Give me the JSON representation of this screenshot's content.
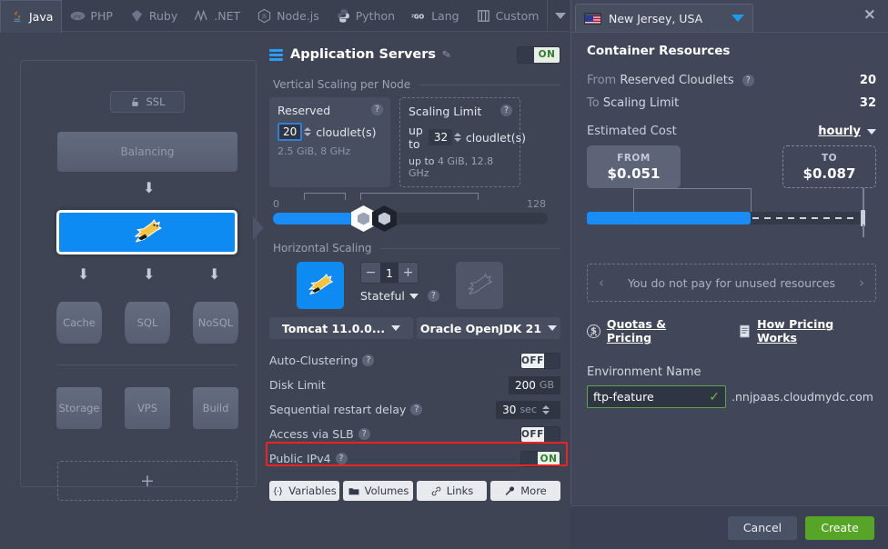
{
  "tabs": [
    {
      "label": "Java",
      "icon": "java-icon",
      "active": true
    },
    {
      "label": "PHP",
      "icon": "php-icon",
      "active": false
    },
    {
      "label": "Ruby",
      "icon": "ruby-icon",
      "active": false
    },
    {
      "label": ".NET",
      "icon": "dotnet-icon",
      "active": false
    },
    {
      "label": "Node.js",
      "icon": "nodejs-icon",
      "active": false
    },
    {
      "label": "Python",
      "icon": "python-icon",
      "active": false
    },
    {
      "label": "Lang",
      "icon": "go-icon",
      "active": false
    },
    {
      "label": "Custom",
      "icon": "custom-icon",
      "active": false
    }
  ],
  "topology": {
    "ssl_label": "SSL",
    "balancing_label": "Balancing",
    "selected_node": "tomcat-node",
    "databases": [
      "Cache",
      "SQL",
      "NoSQL"
    ],
    "services": [
      "Storage",
      "VPS",
      "Build"
    ],
    "add_label": "+"
  },
  "middle": {
    "title": "Application Servers",
    "enabled_label": "ON",
    "vertical_section": "Vertical Scaling per Node",
    "reserved": {
      "title": "Reserved",
      "value": "20",
      "unit": "cloudlet(s)",
      "detail": "2.5 GiB, 8 GHz"
    },
    "scaling_limit": {
      "title": "Scaling Limit",
      "prefix": "up to",
      "value": "32",
      "unit": "cloudlet(s)",
      "detail_prefix": "up to",
      "detail": "4 GiB, 12.8 GHz"
    },
    "slider": {
      "min": "0",
      "max": "128"
    },
    "horizontal_section": "Horizontal Scaling",
    "node_count": "1",
    "stateful_label": "Stateful",
    "stack_dropdown": "Tomcat 11.0.0...",
    "jdk_dropdown": "Oracle OpenJDK 21",
    "options": [
      {
        "label": "Auto-Clustering",
        "help": true,
        "control": "toggle",
        "value": "OFF",
        "state": "off",
        "highlighted": false
      },
      {
        "label": "Disk Limit",
        "help": false,
        "control": "value",
        "value": "200",
        "unit": "GB",
        "highlighted": false
      },
      {
        "label": "Sequential restart delay",
        "help": true,
        "control": "spinner",
        "value": "30",
        "unit": "sec",
        "highlighted": false
      },
      {
        "label": "Access via SLB",
        "help": true,
        "control": "toggle",
        "value": "OFF",
        "state": "off",
        "highlighted": false
      },
      {
        "label": "Public IPv4",
        "help": true,
        "control": "toggle",
        "value": "ON",
        "state": "on",
        "highlighted": true
      }
    ],
    "buttons": [
      {
        "label": "Variables",
        "icon": "braces-icon"
      },
      {
        "label": "Volumes",
        "icon": "folder-icon"
      },
      {
        "label": "Links",
        "icon": "link-icon"
      },
      {
        "label": "More",
        "icon": "wrench-icon"
      }
    ]
  },
  "right": {
    "region": "New Jersey, USA",
    "section_title": "Container Resources",
    "rows": [
      {
        "label_muted": "From",
        "label": "Reserved Cloudlets",
        "help": true,
        "value": "20"
      },
      {
        "label_muted": "To",
        "label": "Scaling Limit",
        "help": false,
        "value": "32"
      }
    ],
    "estimated_cost_label": "Estimated Cost",
    "period": "hourly",
    "cost_from_caption": "FROM",
    "cost_from": "$0.051",
    "cost_to_caption": "TO",
    "cost_to": "$0.087",
    "unused_note": "You do not pay for unused resources",
    "links": [
      {
        "label": "Quotas & Pricing",
        "icon": "dollar-circle-icon"
      },
      {
        "label": "How Pricing Works",
        "icon": "document-icon"
      }
    ],
    "env_label": "Environment Name",
    "env_value": "ftp-feature",
    "env_domain": ".nnjpaas.cloudmydc.com"
  },
  "footer": {
    "cancel": "Cancel",
    "create": "Create"
  },
  "colors": {
    "accent_blue": "#0d8bf2",
    "create_green": "#57a527",
    "highlight_red": "#ee2222",
    "panel_bg": "#3e4453"
  }
}
